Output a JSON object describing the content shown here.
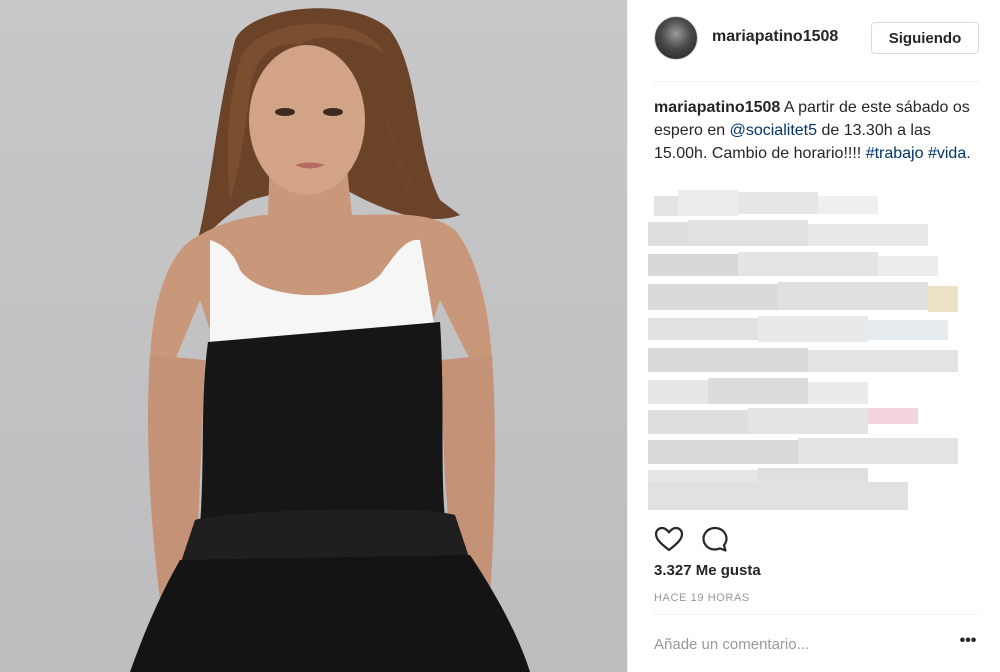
{
  "post": {
    "username": "mariapatino1508",
    "follow_label": "Siguiendo",
    "caption": {
      "username": "mariapatino1508",
      "text_1": " A partir de este sábado os espero en ",
      "mention": "@socialitet5",
      "text_2": " de 13.30h a las 15.00h. Cambio de horario!!!! ",
      "hashtag_1": "#trabajo",
      "hashtag_2": "#vida",
      "text_3": "."
    },
    "likes": "3.327 Me gusta",
    "timestamp": "HACE 19 HORAS",
    "comment_placeholder": "Añade un comentario...",
    "more_label": "•••"
  },
  "icons": {
    "like": "heart-icon",
    "comment": "comment-bubble-icon",
    "more": "more-options-icon"
  },
  "colors": {
    "link": "#003569",
    "text": "#262626",
    "muted": "#999999",
    "border": "#dbdbdb"
  }
}
